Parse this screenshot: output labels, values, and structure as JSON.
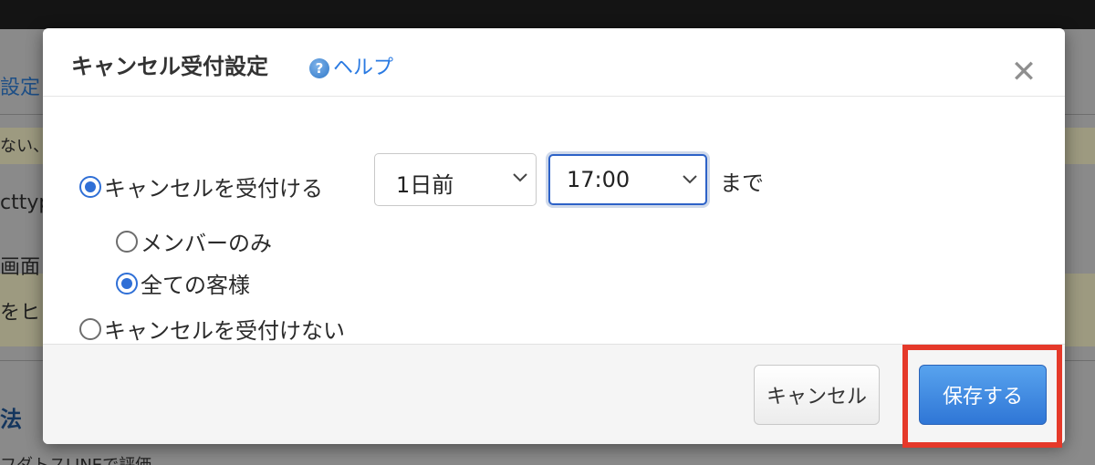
{
  "background": {
    "items": [
      {
        "text": "設定"
      },
      {
        "text": "ない、"
      },
      {
        "text": "cttyp"
      },
      {
        "text": "画面"
      },
      {
        "text": "をヒ"
      },
      {
        "text": "法"
      },
      {
        "text": "フダトスLINEで評価"
      }
    ]
  },
  "dialog": {
    "title": "キャンセル受付設定",
    "help_icon": "question-circle-icon",
    "help_label": "ヘルプ",
    "close_glyph": "✕",
    "options": {
      "accept_label": "キャンセルを受付ける",
      "accept_checked": true,
      "members_only_label": "メンバーのみ",
      "members_only_checked": false,
      "all_customers_label": "全ての客様",
      "all_customers_checked": true,
      "reject_label": "キャンセルを受付けない",
      "reject_checked": false
    },
    "days_select": {
      "value": "1日前"
    },
    "time_select": {
      "value": "17:00"
    },
    "until_label": "まで",
    "cancel_button": "キャンセル",
    "save_button": "保存する"
  },
  "colors": {
    "accent": "#2f6fd6",
    "help_link": "#2a7ae2",
    "highlight_border": "#e5392a",
    "save_button": "#3b82e0"
  }
}
